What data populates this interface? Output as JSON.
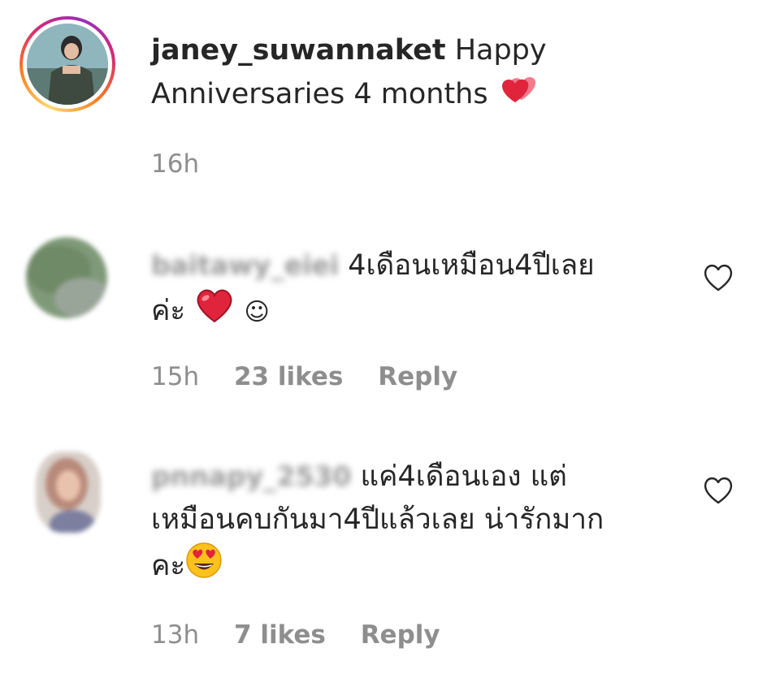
{
  "post": {
    "username": "janey_suwannaket",
    "text_line1": "Happy",
    "text_line2": "Anniversaries 4 months",
    "time": "16h",
    "emoji_icon": "two-hearts-icon"
  },
  "comments": [
    {
      "username": "baitawy_eiei",
      "text_line1": "4เดือนเหมือน4ปีเลย",
      "text_line2": "ค่ะ",
      "emoji_icon": "red-heart-icon",
      "trailing": "☺",
      "time": "15h",
      "likes": "23 likes",
      "reply": "Reply",
      "like_icon": "heart-outline-icon"
    },
    {
      "username": "pnnapy_2530",
      "text_line1": "แค่4เดือนเอง แต่",
      "text_line2": "เหมือนคบกันมา4ปีแล้วเลย น่ารักมาก",
      "text_line3": "คะ",
      "emoji_icon": "heart-eyes-emoji-icon",
      "time": "13h",
      "likes": "7 likes",
      "reply": "Reply",
      "like_icon": "heart-outline-icon"
    }
  ],
  "colors": {
    "text": "#262626",
    "meta": "#8e8e8e",
    "heart_red": "#ed2f45"
  }
}
